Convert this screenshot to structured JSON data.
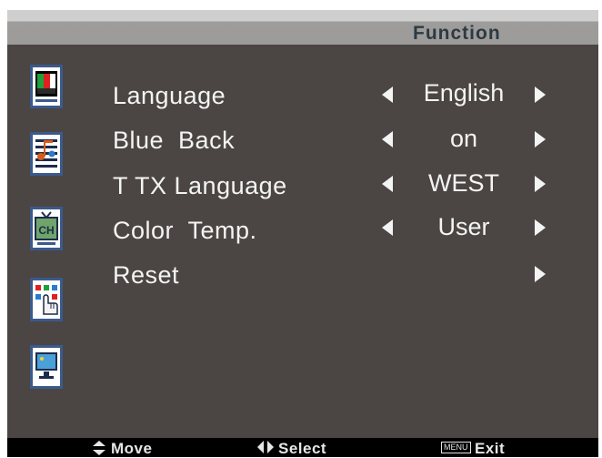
{
  "header": {
    "title": "Function"
  },
  "rows": [
    {
      "label": "Language",
      "value": "English"
    },
    {
      "label": "Blue  Back",
      "value": "on"
    },
    {
      "label": "T TX Language",
      "value": "WEST"
    },
    {
      "label": "Color  Temp.",
      "value": "User"
    },
    {
      "label": "Reset",
      "value": ""
    }
  ],
  "sidebar": [
    {
      "icon": "picture-icon"
    },
    {
      "icon": "sound-icon"
    },
    {
      "icon": "channel-icon"
    },
    {
      "icon": "function-hand-icon"
    },
    {
      "icon": "screen-icon"
    }
  ],
  "footer": {
    "move_label": "Move",
    "select_label": "Select",
    "menu_key": "MENU",
    "exit_label": "Exit"
  },
  "colors": {
    "background": "#4b4643",
    "header": "#9e9d9b",
    "text": "#f4f4f4",
    "title": "#2d3a44"
  }
}
